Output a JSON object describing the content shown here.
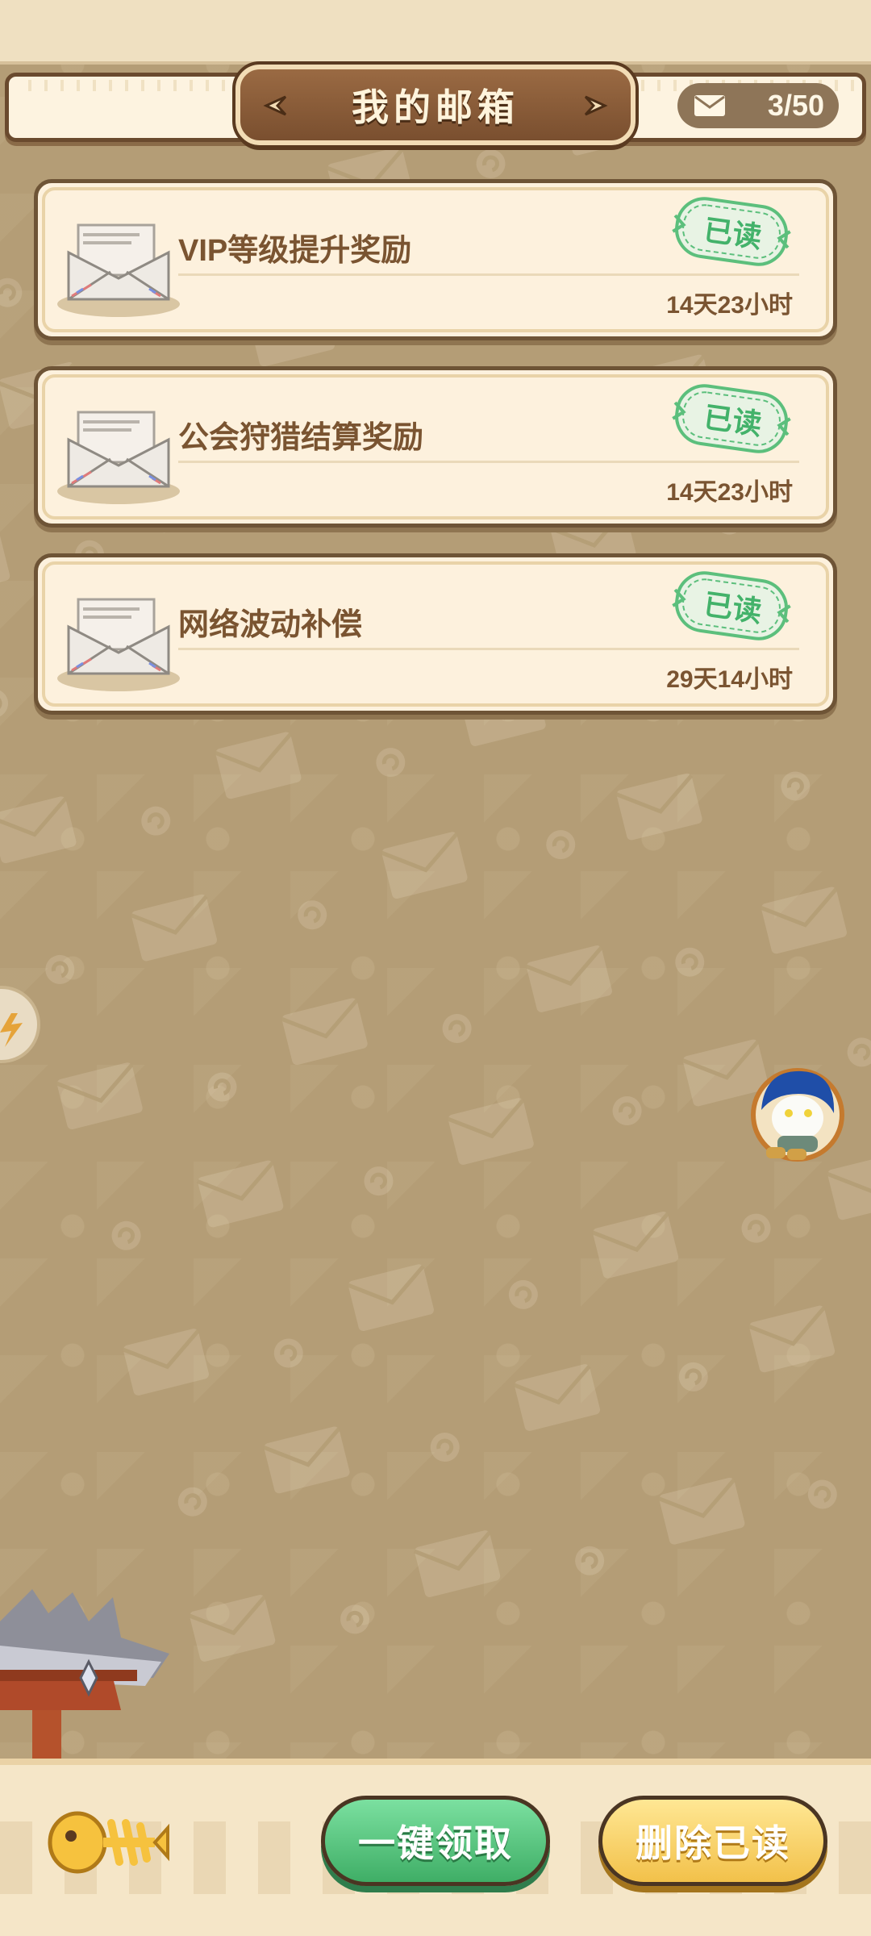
{
  "header": {
    "title": "我的邮箱",
    "mail_count": "3/50",
    "mail_icon": "envelope-icon"
  },
  "mails": [
    {
      "title": "VIP等级提升奖励",
      "status": "已读",
      "time_left": "14天23小时"
    },
    {
      "title": "公会狩猎结算奖励",
      "status": "已读",
      "time_left": "14天23小时"
    },
    {
      "title": "网络波动补偿",
      "status": "已读",
      "time_left": "29天14小时"
    }
  ],
  "footer": {
    "claim_all_label": "一键领取",
    "delete_read_label": "删除已读"
  },
  "colors": {
    "accent_green": "#43b26a",
    "accent_yellow": "#f2c14a",
    "brown_text": "#7a5431",
    "background": "#b49d76"
  }
}
